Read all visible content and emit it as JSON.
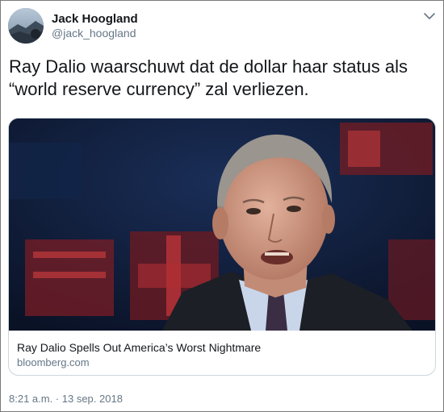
{
  "author": {
    "name": "Jack Hoogland",
    "handle": "@jack_hoogland"
  },
  "tweet": {
    "text": "Ray Dalio waarschuwt dat de dollar haar status als “world reserve currency” zal verliezen.",
    "timestamp": "8:21 a.m. · 13 sep. 2018"
  },
  "card": {
    "title": "Ray Dalio Spells Out America’s Worst Nightmare",
    "domain": "bloomberg.com"
  },
  "icons": {
    "menu": "chevron-down-icon"
  },
  "colors": {
    "text": "#14171a",
    "secondary": "#657786",
    "border": "#ccd6dd"
  }
}
